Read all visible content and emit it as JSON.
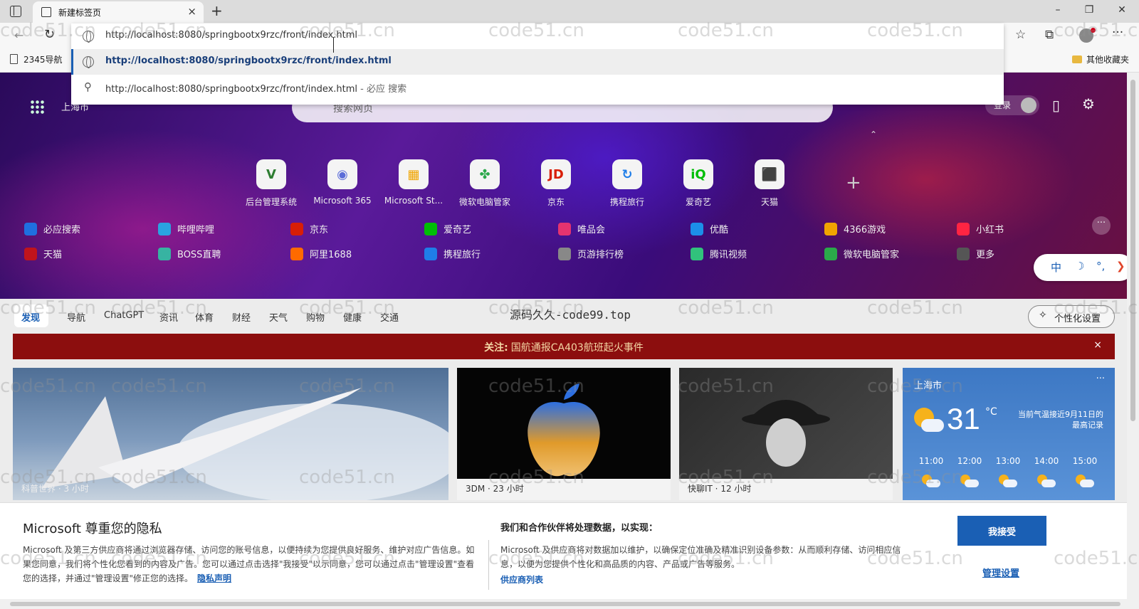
{
  "browser": {
    "tab_title": "新建标签页",
    "tab_close": "×",
    "new_tab": "+",
    "win_minimize": "–",
    "win_restore": "❐",
    "win_close": "✕"
  },
  "omnibox": {
    "input_value": "http://localhost:8080/springbootx9rzc/front/index.html",
    "suggestions": [
      {
        "text": "http://localhost:8080/springbootx9rzc/front/index.html",
        "suffix": ""
      },
      {
        "text": "http://localhost:8080/springbootx9rzc/front/index.html",
        "suffix": " - 必应 搜索"
      }
    ]
  },
  "bookmarks": {
    "item": "2345导航",
    "other": "其他收藏夹"
  },
  "hero": {
    "city": "上海市",
    "search_placeholder": "搜索网页",
    "login": "登录",
    "apps": [
      {
        "label": "后台管理系统",
        "glyph": "V",
        "color": "#2e7d32"
      },
      {
        "label": "Microsoft 365",
        "glyph": "◉",
        "color": "#5b6dd8"
      },
      {
        "label": "Microsoft St...",
        "glyph": "▦",
        "color": "#f0a400"
      },
      {
        "label": "微软电脑管家",
        "glyph": "✤",
        "color": "#2ba84a"
      },
      {
        "label": "京东",
        "glyph": "JD",
        "color": "#d81e06"
      },
      {
        "label": "携程旅行",
        "glyph": "↻",
        "color": "#1f7ee8"
      },
      {
        "label": "爱奇艺",
        "glyph": "iQ",
        "color": "#00be06"
      },
      {
        "label": "天猫",
        "glyph": "⬛",
        "color": "#c0141c"
      }
    ],
    "links_row1": [
      "必应搜索",
      "哔哩哔哩",
      "京东",
      "爱奇艺",
      "唯品会",
      "优酷",
      "4366游戏",
      "小红书"
    ],
    "links_row2": [
      "天猫",
      "BOSS直聘",
      "阿里1688",
      "携程旅行",
      "页游排行榜",
      "腾讯视频",
      "微软电脑管家",
      "更多"
    ],
    "link_colors_row1": [
      "#1f6fe0",
      "#2aa3e0",
      "#d81e06",
      "#00be06",
      "#e5336f",
      "#1c8fe8",
      "#f0a400",
      "#ff2442"
    ],
    "link_colors_row2": [
      "#c0141c",
      "#37b3a2",
      "#ff6a00",
      "#1f7ee8",
      "#888888",
      "#31c27c",
      "#2ba84a",
      "#555555"
    ],
    "more_dots": "···",
    "ime": [
      "中",
      "☽",
      "°,",
      "❯"
    ]
  },
  "feed": {
    "tabs": [
      "发现",
      "导航",
      "ChatGPT",
      "资讯",
      "体育",
      "财经",
      "天气",
      "购物",
      "健康",
      "交通"
    ],
    "watermark_title": "源码久久-code99.top",
    "personalize": "个性化设置",
    "alert_label": "关注:",
    "alert_text": "国航通报CA403航班起火事件",
    "alert_close": "×",
    "cards": [
      {
        "source": "科普世界 · 3 小时"
      },
      {
        "source": "3DM · 23 小时"
      },
      {
        "source": "快聊IT · 12 小时"
      }
    ]
  },
  "weather": {
    "city": "上海市",
    "temp": "31",
    "unit": "°C",
    "note": "当前气温接近9月11日的最高记录",
    "hours": [
      "11:00",
      "12:00",
      "13:00",
      "14:00",
      "15:00"
    ]
  },
  "privacy": {
    "title": "Microsoft 尊重您的隐私",
    "body": "Microsoft 及第三方供应商将通过浏览器存储、访问您的账号信息，以便持续为您提供良好服务、维护对应广告信息。如果您同意，我们将个性化您看到的内容及广告。您可以通过点击选择\"我接受\"以示同意，您可以通过点击\"管理设置\"查看您的选择，并通过\"管理设置\"修正您的选择。",
    "privacy_link": "隐私声明",
    "title2": "我们和合作伙伴将处理数据，以实现：",
    "body2": "Microsoft 及供应商将对数据加以维护，以确保定位准确及精准识别设备参数：从而顺利存储、访问相应信息，以便为您提供个性化和高品质的内容、产品或广告等服务。",
    "vendor_link": "供应商列表",
    "accept": "我接受",
    "manage": "管理设置"
  },
  "watermark": "code51.cn"
}
